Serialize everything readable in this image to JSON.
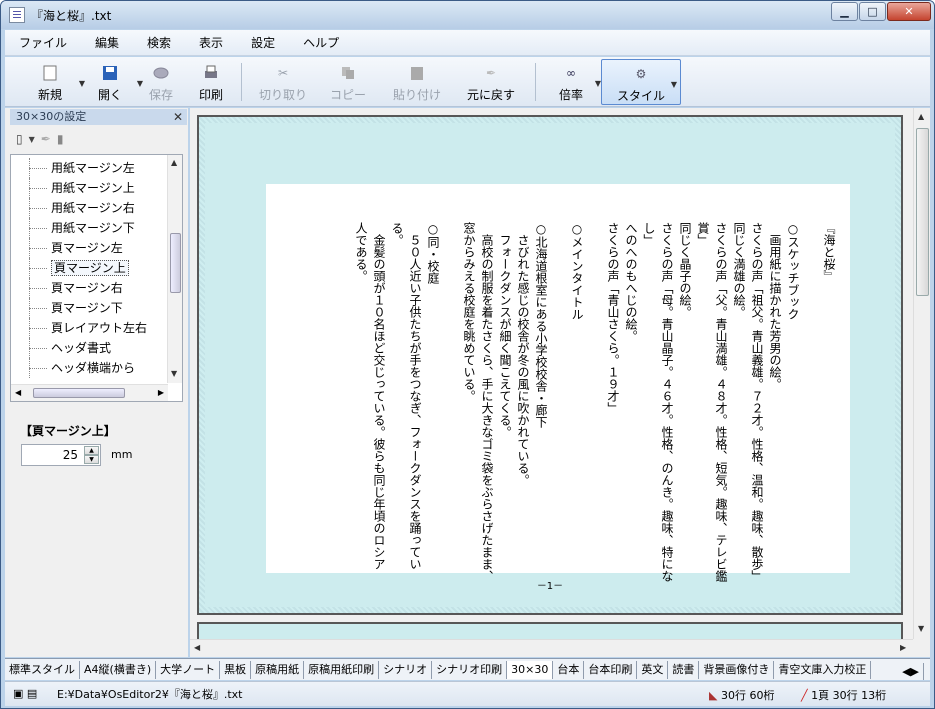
{
  "window": {
    "title": "『海と桜』.txt",
    "min": "▁",
    "max": "□",
    "close": "✕"
  },
  "menu": [
    "ファイル",
    "編集",
    "検索",
    "表示",
    "設定",
    "ヘルプ"
  ],
  "toolbar": {
    "new": "新規",
    "open": "開く",
    "save": "保存",
    "print": "印刷",
    "cut": "切り取り",
    "copy": "コピー",
    "paste": "貼り付け",
    "undo": "元に戻す",
    "zoom": "倍率",
    "style": "スタイル"
  },
  "left_panel": {
    "title": "30×30の設定",
    "tree_items": [
      "用紙マージン左",
      "用紙マージン上",
      "用紙マージン右",
      "用紙マージン下",
      "頁マージン左",
      "頁マージン上",
      "頁マージン右",
      "頁マージン下",
      "頁レイアウト左右",
      "ヘッダ書式",
      "ヘッダ横端から"
    ],
    "selected_index": 5,
    "property_label": "【頁マージン上】",
    "value": "25",
    "unit": "mm"
  },
  "document": {
    "columns": [
      "『海と桜』",
      "",
      "○スケッチブック",
      "　画用紙に描かれた芳男の絵。",
      "さくらの声「祖父。青山義雄。７２才。性格、温和。趣味、散歩」",
      "同じく満雄の絵。",
      "さくらの声「父。青山満雄。４８才。性格、短気。趣味、テレビ鑑",
      "賞」",
      "同じく晶子の絵。",
      "さくらの声「母。青山晶子。４６才。性格、のんき。趣味、特にな",
      "し」",
      "へのへのもへじの絵。",
      "さくらの声「青山さくら。１９才」",
      "",
      "○メインタイトル",
      "",
      "○北海道根室にある小学校校舎・廊下",
      "　さびれた感じの校舎が冬の風に吹かれている。",
      "　フォークダンスが細く聞こえてくる。",
      "　高校の制服を着たさくら、手に大きなゴミ袋をぶらさげたまま、",
      "窓からみえる校庭を眺めている。",
      "",
      "○同・校庭",
      "　５０人近い子供たちが手をつなぎ、フォークダンスを踊ってい",
      "る。",
      "　金髪の頭が１０名ほど交じっている。彼らも同じ年頃のロシア",
      "人である。"
    ],
    "page_number": "－1－"
  },
  "tabs": [
    "標準スタイル",
    "A4縦(横書き)",
    "大学ノート",
    "黒板",
    "原稿用紙",
    "原稿用紙印刷",
    "シナリオ",
    "シナリオ印刷",
    "30×30",
    "台本",
    "台本印刷",
    "英文",
    "読書",
    "背景画像付き",
    "青空文庫入力校正"
  ],
  "active_tab": "30×30",
  "status": {
    "path": "E:¥Data¥OsEditor2¥『海と桜』.txt",
    "cols": "30行 60桁",
    "pos": "1頁 30行 13桁"
  }
}
